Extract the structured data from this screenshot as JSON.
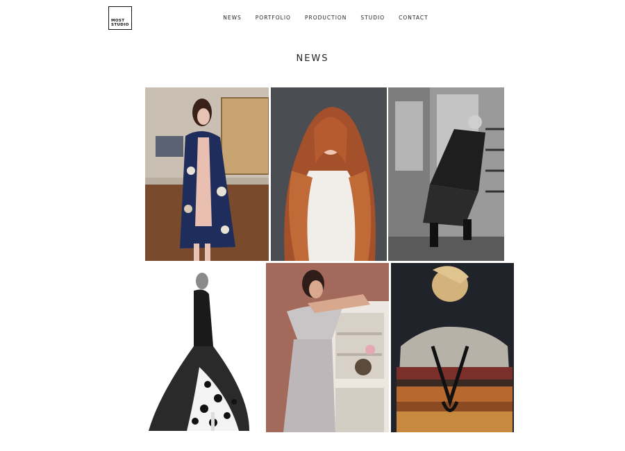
{
  "header": {
    "logo": {
      "line1": "MOST",
      "line2": "STUDIO"
    },
    "nav": [
      {
        "label": "NEWS"
      },
      {
        "label": "PORTFOLIO"
      },
      {
        "label": "PRODUCTION"
      },
      {
        "label": "STUDIO"
      },
      {
        "label": "CONTACT"
      }
    ]
  },
  "main": {
    "title": "NEWS"
  }
}
